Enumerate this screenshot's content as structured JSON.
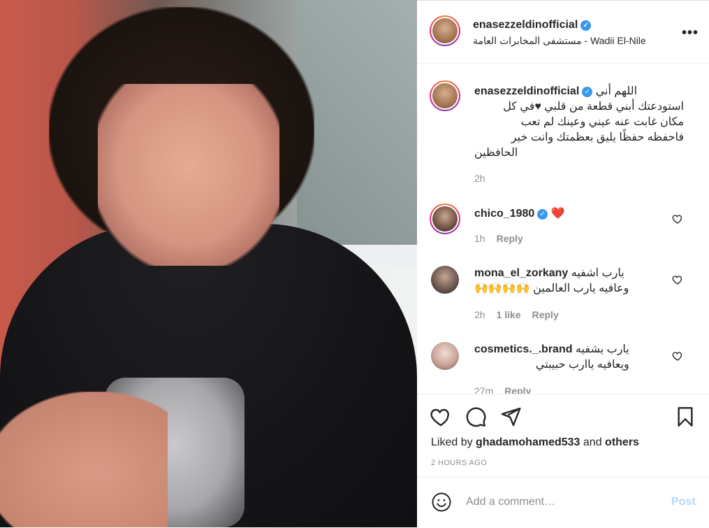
{
  "post": {
    "username": "enasezzeldinofficial",
    "location": "مستشفى المخابرات العامة - Wadii El-Nile",
    "more_icon": "more-options-icon",
    "caption": {
      "username": "enasezzeldinofficial",
      "line1": "اللهم أني",
      "line2": "استودعتك أبني قطعة من قلبي ♥في كل",
      "line3": "مكان غابت عنه عيني وعينك لم تعب",
      "line4": "فاحفظه حفظًا يليق بعظمتك وانت خير",
      "line5": "الحافظين",
      "time": "2h"
    }
  },
  "comments": [
    {
      "username": "chico_1980",
      "text": "❤️",
      "time": "1h",
      "likes": "",
      "reply": "Reply"
    },
    {
      "username": "mona_el_zorkany",
      "line1": "يارب اشفيه",
      "line2": "وعافيه يارب العالمين 🙌🙌🙌🙌",
      "time": "2h",
      "likes": "1 like",
      "reply": "Reply"
    },
    {
      "username": "cosmetics._.brand",
      "line1": "يارب يشفيه",
      "line2": "ويعافيه ياارب حبيبتي",
      "time": "27m",
      "reply": "Reply"
    }
  ],
  "actions": {
    "liked_prefix": "Liked by",
    "liked_user": "ghadamohamed533",
    "liked_and": "and",
    "liked_others": "others",
    "time_ago": "2 HOURS AGO"
  },
  "composer": {
    "placeholder": "Add a comment…",
    "post_label": "Post"
  },
  "colors": {
    "verified": "#3897f0",
    "muted": "#8e8e8e",
    "post_disabled": "#b3dbff"
  }
}
